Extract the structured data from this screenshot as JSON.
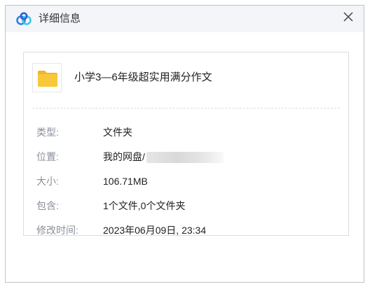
{
  "window": {
    "title": "详细信息",
    "logo_icon": "baidu-netdisk-logo",
    "close_icon": "close-icon"
  },
  "item": {
    "icon": "folder-icon",
    "name": "小学3—6年级超实用满分作文"
  },
  "details": [
    {
      "label": "类型:",
      "value": "文件夹"
    },
    {
      "label": "位置:",
      "value": "我的网盘/"
    },
    {
      "label": "大小:",
      "value": "106.71MB"
    },
    {
      "label": "包含:",
      "value": "1个文件,0个文件夹"
    },
    {
      "label": "修改时间:",
      "value": "2023年06月09日, 23:34"
    }
  ],
  "colors": {
    "folder": "#f8c83a",
    "logo_blue": "#2f7fe8",
    "logo_cyan": "#3bc6e6"
  }
}
